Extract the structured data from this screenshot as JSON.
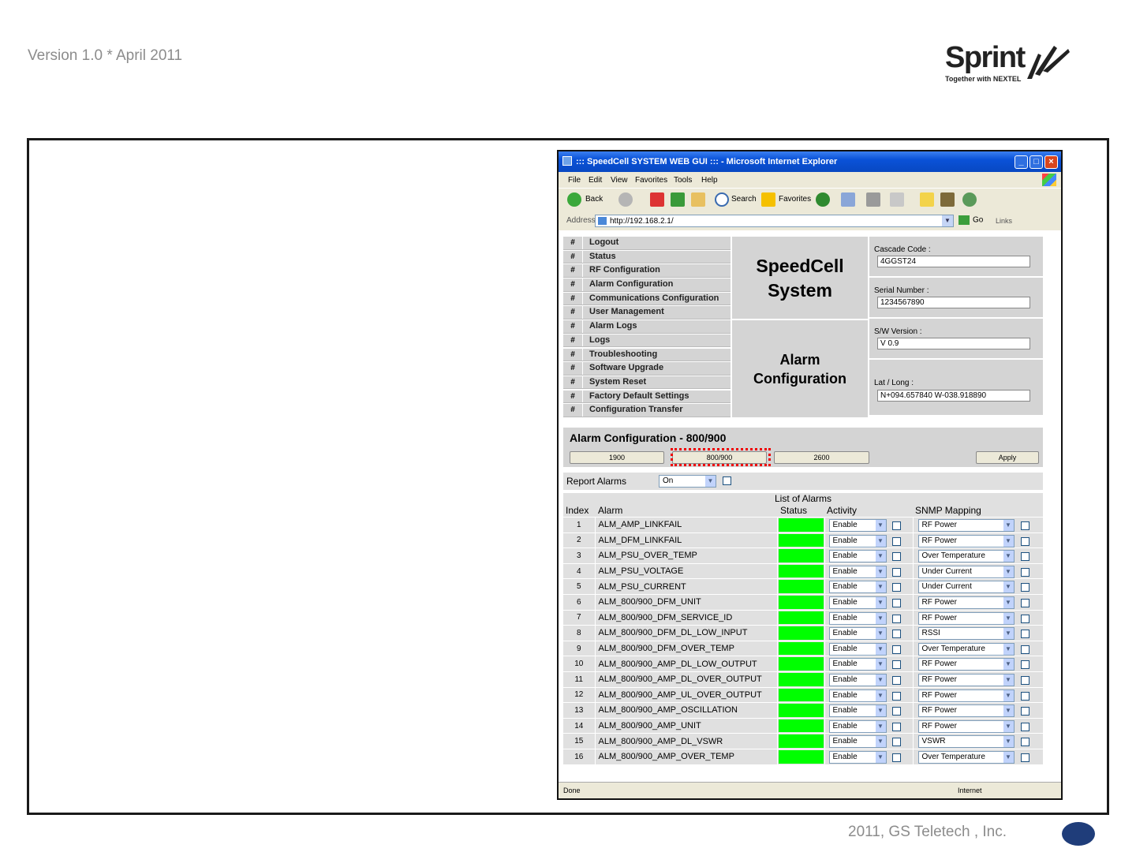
{
  "slide": {
    "version": "Version 1.0 * April 2011",
    "footer": "2011, GS Teletech , Inc.",
    "logo": {
      "word": "Sprint",
      "tagline": "Together with NEXTEL"
    }
  },
  "window": {
    "title": "::: SpeedCell SYSTEM WEB GUI ::: - Microsoft Internet Explorer",
    "menu": [
      "File",
      "Edit",
      "View",
      "Favorites",
      "Tools",
      "Help"
    ],
    "toolbar": {
      "back": "Back",
      "search": "Search",
      "favorites": "Favorites"
    },
    "address_label": "Address",
    "address": "http://192.168.2.1/",
    "go": "Go",
    "links": "Links",
    "status_left": "Done",
    "status_right": "Internet"
  },
  "nav": {
    "hash": "#",
    "items": [
      "Logout",
      "Status",
      "RF Configuration",
      "Alarm Configuration",
      "Communications Configuration",
      "User Management",
      "Alarm Logs",
      "Logs",
      "Troubleshooting",
      "Software Upgrade",
      "System Reset",
      "Factory Default Settings",
      "Configuration Transfer"
    ]
  },
  "header": {
    "system_line1": "SpeedCell",
    "system_line2": "System",
    "page_line1": "Alarm",
    "page_line2": "Configuration"
  },
  "info": [
    {
      "label": "Cascade Code :",
      "value": "4GGST24"
    },
    {
      "label": "Serial Number :",
      "value": "1234567890"
    },
    {
      "label": "S/W Version :",
      "value": "V 0.9"
    },
    {
      "label": "Lat / Long :",
      "value": "N+094.657840 W-038.918890"
    }
  ],
  "alarm_config": {
    "title": "Alarm Configuration - 800/900",
    "bands": [
      "1900",
      "800/900",
      "2600"
    ],
    "selected_band": "800/900",
    "apply": "Apply",
    "report_label": "Report Alarms",
    "report_value": "On"
  },
  "alarm_list": {
    "caption": "List of Alarms",
    "columns": [
      "Index",
      "Alarm",
      "Status",
      "Activity",
      "SNMP Mapping"
    ],
    "status_color": "#00ff00",
    "rows": [
      {
        "index": "1",
        "alarm": "ALM_AMP_LINKFAIL",
        "activity": "Enable",
        "snmp": "RF Power"
      },
      {
        "index": "2",
        "alarm": "ALM_DFM_LINKFAIL",
        "activity": "Enable",
        "snmp": "RF Power"
      },
      {
        "index": "3",
        "alarm": "ALM_PSU_OVER_TEMP",
        "activity": "Enable",
        "snmp": "Over Temperature"
      },
      {
        "index": "4",
        "alarm": "ALM_PSU_VOLTAGE",
        "activity": "Enable",
        "snmp": "Under Current"
      },
      {
        "index": "5",
        "alarm": "ALM_PSU_CURRENT",
        "activity": "Enable",
        "snmp": "Under Current"
      },
      {
        "index": "6",
        "alarm": "ALM_800/900_DFM_UNIT",
        "activity": "Enable",
        "snmp": "RF Power"
      },
      {
        "index": "7",
        "alarm": "ALM_800/900_DFM_SERVICE_ID",
        "activity": "Enable",
        "snmp": "RF Power"
      },
      {
        "index": "8",
        "alarm": "ALM_800/900_DFM_DL_LOW_INPUT",
        "activity": "Enable",
        "snmp": "RSSI"
      },
      {
        "index": "9",
        "alarm": "ALM_800/900_DFM_OVER_TEMP",
        "activity": "Enable",
        "snmp": "Over Temperature"
      },
      {
        "index": "10",
        "alarm": "ALM_800/900_AMP_DL_LOW_OUTPUT",
        "activity": "Enable",
        "snmp": "RF Power"
      },
      {
        "index": "11",
        "alarm": "ALM_800/900_AMP_DL_OVER_OUTPUT",
        "activity": "Enable",
        "snmp": "RF Power"
      },
      {
        "index": "12",
        "alarm": "ALM_800/900_AMP_UL_OVER_OUTPUT",
        "activity": "Enable",
        "snmp": "RF Power"
      },
      {
        "index": "13",
        "alarm": "ALM_800/900_AMP_OSCILLATION",
        "activity": "Enable",
        "snmp": "RF Power"
      },
      {
        "index": "14",
        "alarm": "ALM_800/900_AMP_UNIT",
        "activity": "Enable",
        "snmp": "RF Power"
      },
      {
        "index": "15",
        "alarm": "ALM_800/900_AMP_DL_VSWR",
        "activity": "Enable",
        "snmp": "VSWR"
      },
      {
        "index": "16",
        "alarm": "ALM_800/900_AMP_OVER_TEMP",
        "activity": "Enable",
        "snmp": "Over Temperature"
      }
    ]
  }
}
